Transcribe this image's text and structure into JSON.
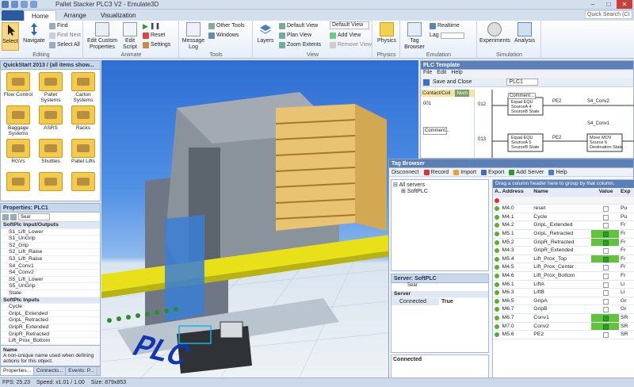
{
  "window": {
    "title": "Pallet Stacker PLC3 V2 - Emulate3D",
    "search_placeholder": "Quick Search (Ct"
  },
  "tabs": [
    "Home",
    "Arrange",
    "Visualization"
  ],
  "ribbon": {
    "editing": {
      "label": "Editing",
      "select": "Select",
      "navigate": "Navigate",
      "find": "Find",
      "find_next": "Find Next",
      "select_all": "Select All"
    },
    "animate": {
      "label": "Animate",
      "edit_custom_properties": "Edit Custom Properties",
      "edit_script": "Edit Script",
      "reset": "Reset",
      "settings": "Settings"
    },
    "tools": {
      "label": "Tools",
      "message_log": "Message Log",
      "other_tools": "Other Tools",
      "windows": "Windows"
    },
    "view": {
      "label": "View",
      "layers": "Layers",
      "default_view": "Default View",
      "plan_view": "Plan View",
      "zoom_extents": "Zoom Extents",
      "view_select": "Default View",
      "add_view": "Add View",
      "remove_view": "Remove View"
    },
    "physics": {
      "label": "Physics",
      "physics": "Physics"
    },
    "emulation": {
      "label": "Emulation",
      "tag_browser": "Tag Browser",
      "realtime": "Realtime",
      "lag": "Lag"
    },
    "simulation": {
      "label": "Simulation",
      "experiments": "Experiments",
      "analysis": "Analysis"
    }
  },
  "quickstart": {
    "title": "QuickStart 2013 / (all items show...",
    "items": [
      "Flow Control",
      "Pallet Systems",
      "Carton Systems",
      "Baggage Systems",
      "ASRS",
      "Racks",
      "RGVs",
      "Shuttles",
      "Pallet Lifts",
      "",
      "",
      ""
    ]
  },
  "properties": {
    "title": "Properties: PLC1",
    "search_placeholder": "Sear",
    "rows": [
      {
        "t": "SoftPlc Input/Outputs",
        "cat": true
      },
      {
        "t": "S1_Lift_Lower"
      },
      {
        "t": "S1_UnGrip"
      },
      {
        "t": "S2_Grip"
      },
      {
        "t": "S2_Lift_Raise"
      },
      {
        "t": "S3_Lift_Raise"
      },
      {
        "t": "S4_Conv1"
      },
      {
        "t": "S4_Conv2"
      },
      {
        "t": "S5_Lift_Lower"
      },
      {
        "t": "S5_UnGrip"
      },
      {
        "t": "State"
      },
      {
        "t": "SoftPlc Inputs",
        "cat": true
      },
      {
        "t": "Cycle"
      },
      {
        "t": "GripL_Extended"
      },
      {
        "t": "GripL_Retracted"
      },
      {
        "t": "GripR_Extended"
      },
      {
        "t": "GripR_Retracted"
      },
      {
        "t": "Lift_Prox_Bottom"
      }
    ],
    "desc_title": "Name",
    "desc": "A non-unique name used when defining actions for this object."
  },
  "bottom_tabs": [
    "Properties...",
    "Connecto...",
    "Events: P..."
  ],
  "status": {
    "fps": "FPS: 25.23",
    "speed": "Speed: x1.01 / 1.00",
    "size": "Size: 879x853"
  },
  "viewport": {
    "floor_label": "PLC"
  },
  "plc_template": {
    "title": "PLC Template",
    "menu": [
      "File",
      "Edit",
      "Help"
    ],
    "save_close": "Save and Close",
    "plc_name": "PLC1",
    "palette": "Contact/Coil",
    "palette2": "Num",
    "rungs": [
      {
        "num": "001",
        "comment": ""
      },
      {
        "num": "012",
        "comment": "Comment..."
      },
      {
        "num": "013",
        "comment": "Comment..."
      }
    ],
    "blocks": [
      {
        "title": "EQU",
        "lines": [
          "Equal",
          "SourceA",
          "SourceB"
        ],
        "vals": [
          "EQU",
          "4",
          "State"
        ],
        "tag": "PE2"
      },
      {
        "title": "S4_Conv2",
        "lines": [],
        "vals": [],
        "tag": ""
      },
      {
        "title": "S4_Conv1",
        "lines": [],
        "vals": [],
        "tag": ""
      },
      {
        "title": "EQU",
        "lines": [
          "Equal",
          "SourceA",
          "SourceB"
        ],
        "vals": [
          "EQU",
          "5",
          "State"
        ],
        "tag": "PE2"
      },
      {
        "title": "MOV",
        "lines": [
          "Move",
          "Source",
          "Destination"
        ],
        "vals": [
          "MOV",
          "6",
          "State"
        ],
        "tag": ""
      }
    ]
  },
  "tagbrowser": {
    "title": "Tag Browser",
    "toolbar": [
      "Disconnect",
      "Record",
      "Import",
      "Export",
      "Add Server",
      "Help"
    ],
    "tree_root": "All servers",
    "tree_child": "SoftPLC",
    "server_title": "Server: SoftPLC",
    "server_search": "Sear",
    "server_cat": "Server",
    "server_key": "Connected",
    "server_val": "True",
    "status": "Connected",
    "group_hint": "Drag a column header here to group by that column.",
    "headers": [
      "A...",
      "Address",
      "Name",
      "Value",
      "Exp"
    ],
    "rows": [
      {
        "addr": "M4.0",
        "name": "reset",
        "val": false,
        "exp": "Pu"
      },
      {
        "addr": "M4.1",
        "name": "Cycle",
        "val": false,
        "exp": "Pu"
      },
      {
        "addr": "M4.2",
        "name": "GripL_Extended",
        "val": false,
        "exp": "Fr"
      },
      {
        "addr": "M5.1",
        "name": "GripL_Retracted",
        "val": true,
        "exp": "Fr"
      },
      {
        "addr": "M5.2",
        "name": "GripR_Retracted",
        "val": true,
        "exp": "Fr"
      },
      {
        "addr": "M4.3",
        "name": "GripR_Extended",
        "val": false,
        "exp": "Fr"
      },
      {
        "addr": "M5.4",
        "name": "Lift_Prox_Top",
        "val": true,
        "exp": "Fr"
      },
      {
        "addr": "M4.5",
        "name": "Lift_Prox_Center",
        "val": false,
        "exp": "Fr"
      },
      {
        "addr": "M4.6",
        "name": "Lift_Prox_Bottom",
        "val": false,
        "exp": "Fr"
      },
      {
        "addr": "M6.1",
        "name": "LiftA",
        "val": false,
        "exp": "Li"
      },
      {
        "addr": "M6.3",
        "name": "LiftB",
        "val": false,
        "exp": "Li"
      },
      {
        "addr": "M6.5",
        "name": "GripA",
        "val": false,
        "exp": "Gr"
      },
      {
        "addr": "M6.7",
        "name": "GripB",
        "val": false,
        "exp": "Gr"
      },
      {
        "addr": "M6.7",
        "name": "Conv1",
        "val": true,
        "exp": "SR"
      },
      {
        "addr": "M7.0",
        "name": "Conv2",
        "val": true,
        "exp": "SR"
      },
      {
        "addr": "M5.6",
        "name": "PE2",
        "val": false,
        "exp": "SR"
      }
    ]
  }
}
